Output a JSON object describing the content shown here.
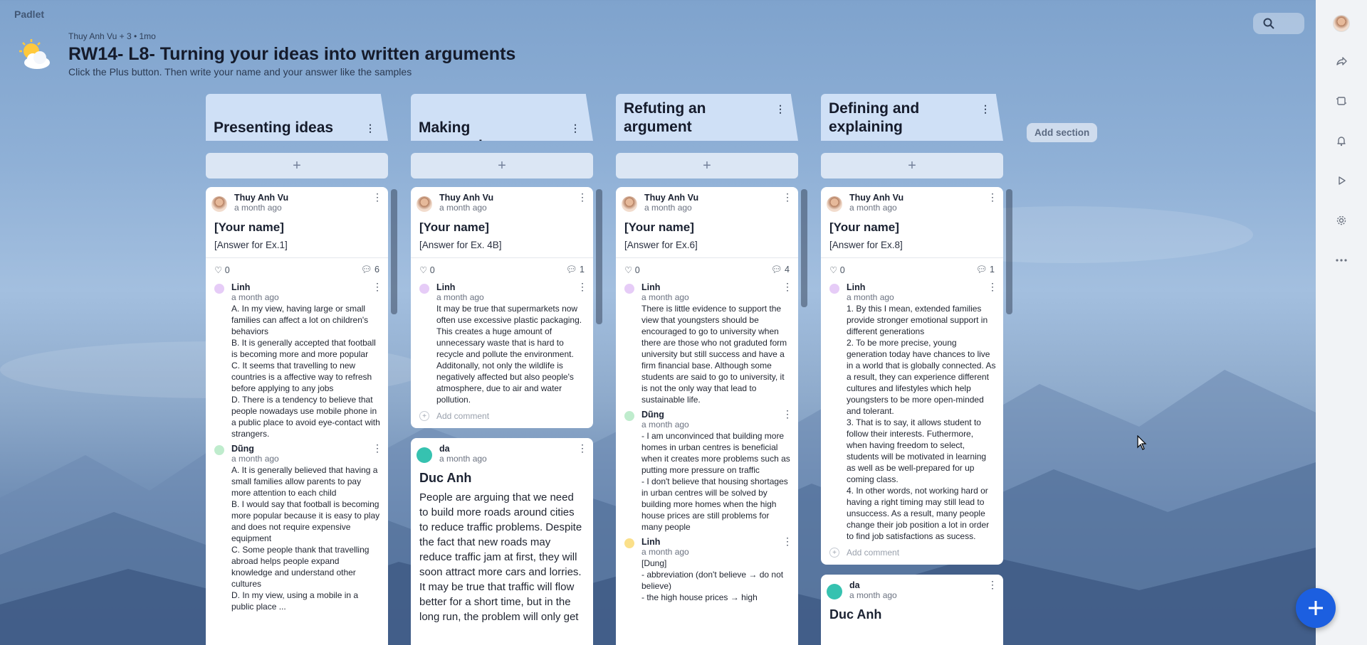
{
  "app": {
    "brand": "Padlet"
  },
  "header": {
    "meta": "Thuy Anh Vu + 3 • 1mo",
    "title": "RW14- L8- Turning your ideas into written arguments",
    "description": "Click the Plus button. Then write your name and your answer like the samples"
  },
  "toolbar": {
    "add_section_label": "Add section",
    "add_post_symbol": "+",
    "add_comment_placeholder": "Add comment"
  },
  "right_bar": {
    "icons": [
      "avatar-icon",
      "share-icon",
      "remake-icon",
      "bell-icon",
      "slideshow-icon",
      "gear-icon",
      "more-icon"
    ]
  },
  "colors": {
    "fab": "#1c5fe0",
    "section_header": "#cfe0f6",
    "card": "#ffffff"
  },
  "columns": [
    {
      "title": "Presenting ideas",
      "post": {
        "author": "Thuy Anh Vu",
        "time": "a month ago",
        "title": "[Your name]",
        "body": "[Answer for Ex.1]",
        "likes": "0",
        "comments": "6"
      },
      "comments": [
        {
          "name": "Linh",
          "time": "a month ago",
          "text": "A. In my view, having large or small families can affect a lot on children's behaviors\nB. It is generally accepted that football is becoming more and more popular\nC. It seems that travelling to new countries is a affective way to refresh before applying to any jobs\nD. There is a tendency to believe that people nowadays use mobile phone in a public place to avoid eye-contact with strangers."
        },
        {
          "name": "Dũng",
          "time": "a month ago",
          "text": "A. It is generally believed that having a small families allow parents to pay more attention to each child\nB. I would say that football is becoming more popular because it is easy to play and does not require expensive equipment\nC. Some people thank that travelling abroad helps people expand knowledge and understand other cultures\nD. In my view, using a mobile in a public place ..."
        }
      ]
    },
    {
      "title": "Making concessions",
      "post": {
        "author": "Thuy Anh Vu",
        "time": "a month ago",
        "title": "[Your name]",
        "body": "[Answer for Ex. 4B]",
        "likes": "0",
        "comments": "1"
      },
      "comments": [
        {
          "name": "Linh",
          "time": "a month ago",
          "text": "It may be true that supermarkets now often use excessive plastic packaging. This creates a huge amount of unnecessary waste that is hard to recycle and pollute the environment. Additonally, not only the wildlife is negatively affected but also people's atmosphere, due to air and water pollution."
        }
      ],
      "post2": {
        "author": "da",
        "time": "a month ago",
        "title": "Duc Anh",
        "body": "People are arguing that we need to build more roads around cities to reduce traffic problems. Despite the fact that new roads may reduce traffic jam at first, they will soon attract more cars and lorries. It may be true that traffic will flow better for a short time, but in the long run, the problem will only get"
      }
    },
    {
      "title": "Refuting an argument",
      "post": {
        "author": "Thuy Anh Vu",
        "time": "a month ago",
        "title": "[Your name]",
        "body": "[Answer for Ex.6]",
        "likes": "0",
        "comments": "4"
      },
      "comments": [
        {
          "name": "Linh",
          "time": "a month ago",
          "text": "There is little evidence to support the view that youngsters should be encouraged to go to university when there are those who not graduted form university but still success and have a firm financial base. Although some students are said to go to university, it is not the only way that lead to sustainable life."
        },
        {
          "name": "Dũng",
          "time": "a month ago",
          "text": "- I am unconvinced that building more homes in urban centres is beneficial when it creates more problems such as putting more pressure on traffic\n- I don't believe that housing shortages in urban centres will be solved by building more homes when the high house prices are still problems for many people"
        },
        {
          "name": "Linh",
          "time": "a month ago",
          "text": "[Dung]\n- abbreviation (don't believe → do not believe)\n- the high house prices → high"
        }
      ]
    },
    {
      "title": "Defining and explaining",
      "post": {
        "author": "Thuy Anh Vu",
        "time": "a month ago",
        "title": "[Your name]",
        "body": "[Answer for Ex.8]",
        "likes": "0",
        "comments": "1"
      },
      "comments": [
        {
          "name": "Linh",
          "time": "a month ago",
          "text": "1. By this I mean, extended families provide stronger emotional support in different generations\n2. To be more precise, young generation today have chances to live in a world that is globally connected. As a result, they can experience different cultures and lifestyles which help youngsters to be more open-minded and tolerant.\n3. That is to say, it allows student to follow their interests. Futhermore, when having freedom to select, students will be motivated in learning as well as be well-prepared for up coming class.\n4. In other words, not working hard or having a right timing may still lead to unsuccess. As a result, many people change their job position a lot in order to find job satisfactions as sucess."
        }
      ],
      "post2": {
        "author": "da",
        "time": "a month ago",
        "title": "Duc Anh"
      }
    }
  ]
}
